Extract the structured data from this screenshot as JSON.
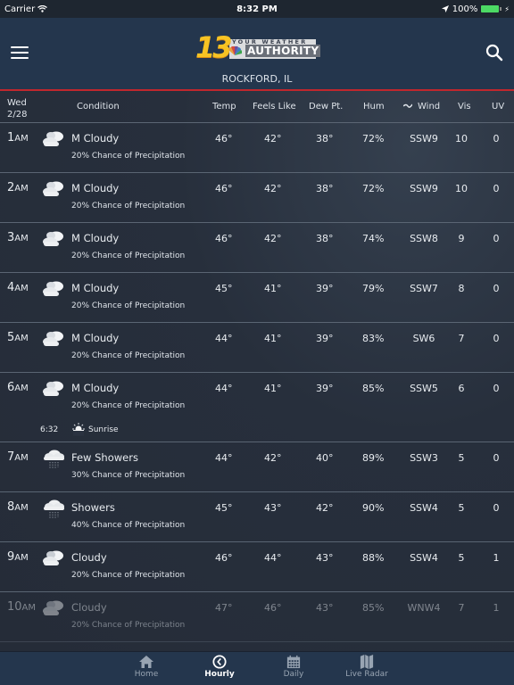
{
  "status_bar": {
    "carrier": "Carrier",
    "time": "8:32 PM",
    "battery": "100%"
  },
  "header": {
    "logo_number": "13",
    "logo_tagline": "YOUR WEATHER",
    "logo_title": "AUTHORITY",
    "location": "ROCKFORD, IL"
  },
  "table": {
    "day": "Wed",
    "date": "2/28",
    "columns": {
      "condition": "Condition",
      "temp": "Temp",
      "feels": "Feels Like",
      "dew": "Dew Pt.",
      "hum": "Hum",
      "wind": "Wind",
      "vis": "Vis",
      "uv": "UV"
    },
    "rows": [
      {
        "hour": "1",
        "ampm": "AM",
        "icon": "mostly-cloudy-icon",
        "condition": "M Cloudy",
        "precip": "20% Chance of Precipitation",
        "temp": "46°",
        "feels": "42°",
        "dew": "38°",
        "hum": "72%",
        "wind": "SSW9",
        "vis": "10",
        "uv": "0"
      },
      {
        "hour": "2",
        "ampm": "AM",
        "icon": "mostly-cloudy-icon",
        "condition": "M Cloudy",
        "precip": "20% Chance of Precipitation",
        "temp": "46°",
        "feels": "42°",
        "dew": "38°",
        "hum": "72%",
        "wind": "SSW9",
        "vis": "10",
        "uv": "0"
      },
      {
        "hour": "3",
        "ampm": "AM",
        "icon": "mostly-cloudy-icon",
        "condition": "M Cloudy",
        "precip": "20% Chance of Precipitation",
        "temp": "46°",
        "feels": "42°",
        "dew": "38°",
        "hum": "74%",
        "wind": "SSW8",
        "vis": "9",
        "uv": "0"
      },
      {
        "hour": "4",
        "ampm": "AM",
        "icon": "mostly-cloudy-icon",
        "condition": "M Cloudy",
        "precip": "20% Chance of Precipitation",
        "temp": "45°",
        "feels": "41°",
        "dew": "39°",
        "hum": "79%",
        "wind": "SSW7",
        "vis": "8",
        "uv": "0"
      },
      {
        "hour": "5",
        "ampm": "AM",
        "icon": "mostly-cloudy-icon",
        "condition": "M Cloudy",
        "precip": "20% Chance of Precipitation",
        "temp": "44°",
        "feels": "41°",
        "dew": "39°",
        "hum": "83%",
        "wind": "SW6",
        "vis": "7",
        "uv": "0"
      },
      {
        "hour": "6",
        "ampm": "AM",
        "icon": "mostly-cloudy-icon",
        "condition": "M Cloudy",
        "precip": "20% Chance of Precipitation",
        "temp": "44°",
        "feels": "41°",
        "dew": "39°",
        "hum": "85%",
        "wind": "SSW5",
        "vis": "6",
        "uv": "0",
        "sunrise_time": "6:32",
        "sunrise_label": "Sunrise"
      },
      {
        "hour": "7",
        "ampm": "AM",
        "icon": "showers-icon",
        "condition": "Few Showers",
        "precip": "30% Chance of Precipitation",
        "temp": "44°",
        "feels": "42°",
        "dew": "40°",
        "hum": "89%",
        "wind": "SSW3",
        "vis": "5",
        "uv": "0"
      },
      {
        "hour": "8",
        "ampm": "AM",
        "icon": "showers-icon",
        "condition": "Showers",
        "precip": "40% Chance of Precipitation",
        "temp": "45°",
        "feels": "43°",
        "dew": "42°",
        "hum": "90%",
        "wind": "SSW4",
        "vis": "5",
        "uv": "0"
      },
      {
        "hour": "9",
        "ampm": "AM",
        "icon": "cloudy-icon",
        "condition": "Cloudy",
        "precip": "20% Chance of Precipitation",
        "temp": "46°",
        "feels": "44°",
        "dew": "43°",
        "hum": "88%",
        "wind": "SSW4",
        "vis": "5",
        "uv": "1"
      },
      {
        "hour": "10",
        "ampm": "AM",
        "icon": "cloudy-icon",
        "condition": "Cloudy",
        "precip": "20% Chance of Precipitation",
        "temp": "47°",
        "feels": "46°",
        "dew": "43°",
        "hum": "85%",
        "wind": "WNW4",
        "vis": "7",
        "uv": "1"
      }
    ]
  },
  "tabbar": {
    "tabs": [
      {
        "label": "Home",
        "icon": "home-icon"
      },
      {
        "label": "Hourly",
        "icon": "clock-icon",
        "active": true
      },
      {
        "label": "Daily",
        "icon": "calendar-icon"
      },
      {
        "label": "Live Radar",
        "icon": "map-icon"
      }
    ]
  }
}
